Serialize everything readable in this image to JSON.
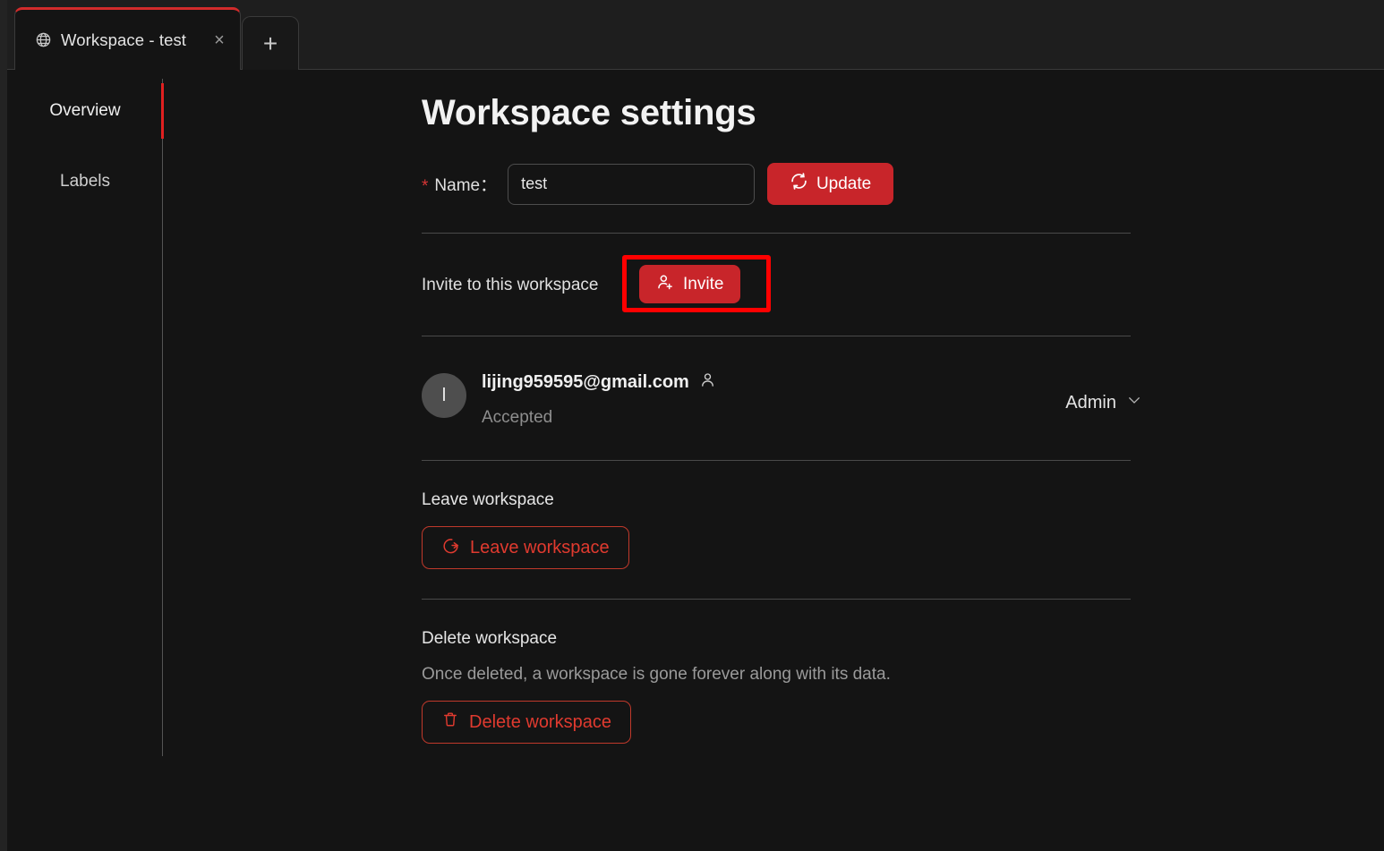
{
  "window": {
    "tab": {
      "icon": "globe-icon",
      "title": "Workspace - test",
      "close_label": "×"
    },
    "new_tab_label": "+"
  },
  "sidebar": {
    "items": [
      {
        "label": "Overview",
        "active": true
      },
      {
        "label": "Labels",
        "active": false
      }
    ]
  },
  "main": {
    "page_title": "Workspace settings",
    "name_field": {
      "required_marker": "*",
      "label": "Name：",
      "value": "test",
      "placeholder": "Name"
    },
    "update_button": {
      "label": "Update",
      "icon": "refresh-icon"
    },
    "invite_section": {
      "label": "Invite to this workspace",
      "button_label": "Invite",
      "button_icon": "user-plus-icon",
      "highlighted": true
    },
    "member": {
      "avatar_initial": "l",
      "email": "lijing959595@gmail.com",
      "email_icon": "user-icon",
      "status": "Accepted",
      "role": "Admin",
      "role_chevron": "chevron-down-icon"
    },
    "leave_section": {
      "title": "Leave workspace",
      "button_label": "Leave workspace",
      "button_icon": "logout-icon"
    },
    "delete_section": {
      "title": "Delete workspace",
      "description": "Once deleted, a workspace is gone forever along with its data.",
      "button_label": "Delete workspace",
      "button_icon": "trash-icon"
    }
  },
  "colors": {
    "background": "#141414",
    "tabbar": "#1e1e1e",
    "accent_red": "#c8252a",
    "danger_outline": "#c0392b",
    "highlight_box": "#ff0000",
    "active_tab_top": "#d22b2b",
    "divider": "#4a4a4a",
    "text_primary": "#f0f0f0",
    "text_muted": "#8e8e8e"
  }
}
